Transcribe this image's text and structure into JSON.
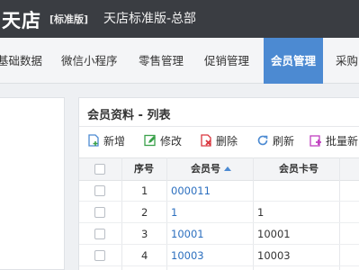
{
  "header": {
    "logo": "天店",
    "edition": "[标准版]",
    "store_title": "天店标准版-总部"
  },
  "nav": {
    "items": [
      "基础数据",
      "微信小程序",
      "零售管理",
      "促销管理",
      "会员管理",
      "采购"
    ],
    "active": "会员管理"
  },
  "panel": {
    "title": "会员资料 - 列表"
  },
  "toolbar": {
    "add": "新增",
    "edit": "修改",
    "delete": "删除",
    "refresh": "刷新",
    "batch": "批量新"
  },
  "table": {
    "headers": {
      "seq": "序号",
      "member_no": "会员号",
      "card_no": "会员卡号"
    },
    "rows": [
      {
        "seq": "1",
        "member_no": "000011",
        "card_no": ""
      },
      {
        "seq": "2",
        "member_no": "1",
        "card_no": "1"
      },
      {
        "seq": "3",
        "member_no": "10001",
        "card_no": "10001"
      },
      {
        "seq": "4",
        "member_no": "10003",
        "card_no": "10003"
      }
    ]
  },
  "colors": {
    "topbar": "#3a3d42",
    "accent": "#4c8ad2",
    "link": "#2c6fbf"
  }
}
